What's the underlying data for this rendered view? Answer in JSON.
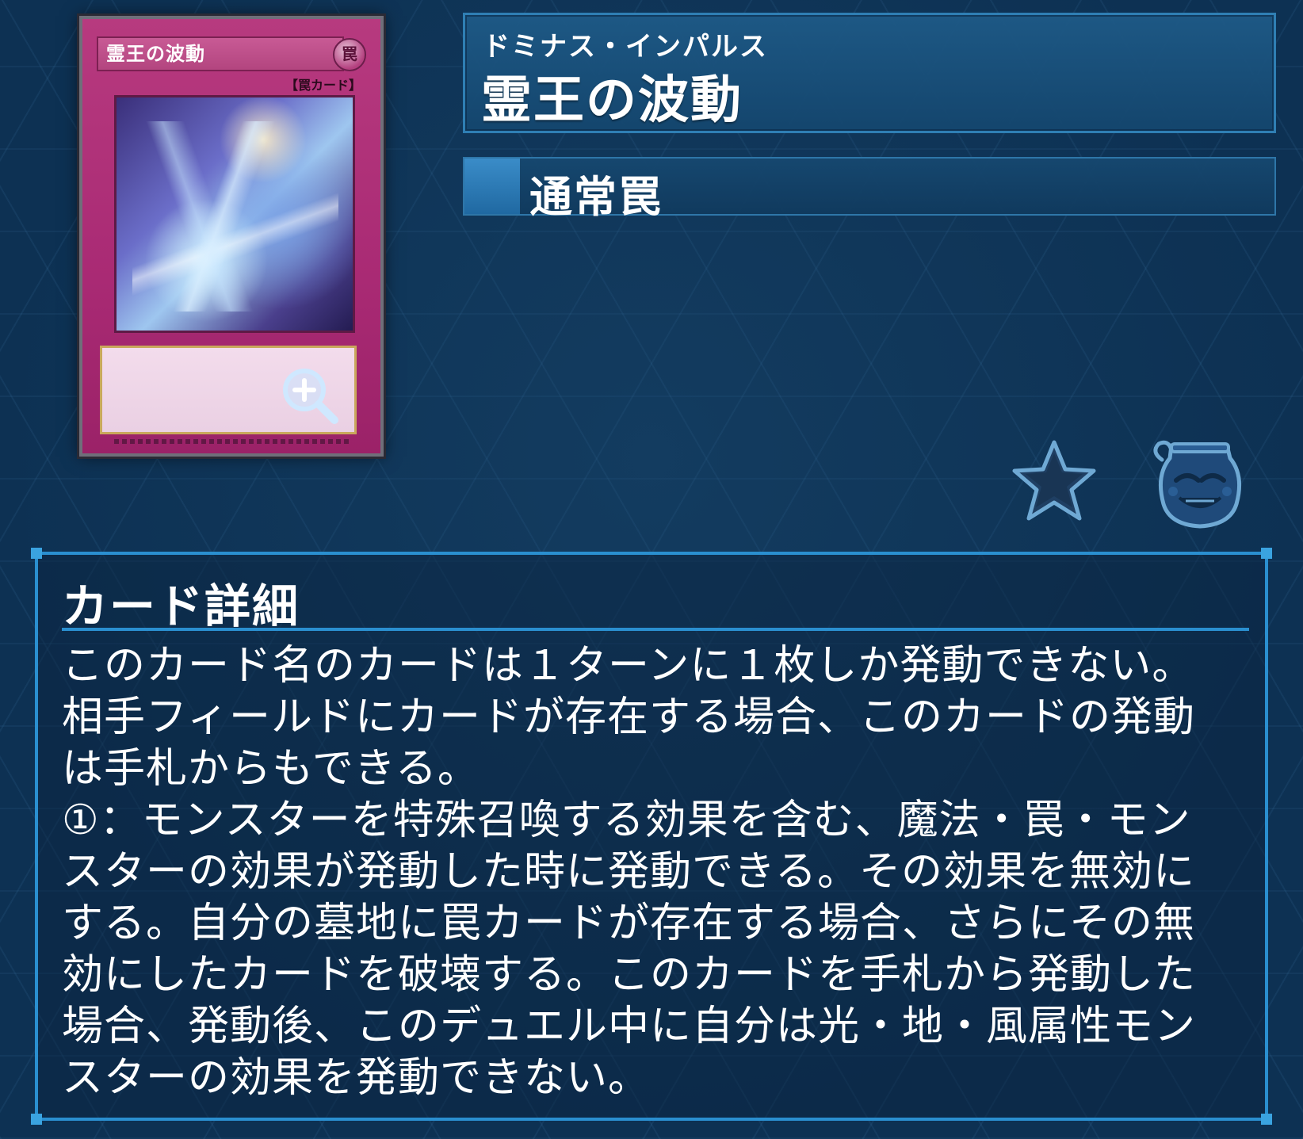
{
  "card": {
    "image_name": "霊王の波動",
    "image_attribute_glyph": "罠",
    "image_type_tag": "【罠カード】",
    "zoom_icon": "zoom-in-icon"
  },
  "header": {
    "reading": "ドミナス・インパルス",
    "name": "霊王の波動",
    "card_type": "通常罠"
  },
  "actions": {
    "favorite_icon": "star-icon",
    "pot_icon": "pot-of-greed-icon"
  },
  "detail": {
    "title": "カード詳細",
    "text": "このカード名のカードは１ターンに１枚しか発動できない。\n相手フィールドにカードが存在する場合、このカードの発動\nは手札からもできる。\n①：モンスターを特殊召喚する効果を含む、魔法・罠・モン\nスターの効果が発動した時に発動できる。その効果を無効に\nする。自分の墓地に罠カードが存在する場合、さらにその無\n効にしたカードを破壊する。このカードを手札から発動した\n場合、発動後、このデュエル中に自分は光・地・風属性モン\nスターの効果を発動できない。"
  },
  "colors": {
    "background": "#0d3153",
    "panel_border": "#2a8fd0",
    "trap_card": "#b73a7f"
  }
}
